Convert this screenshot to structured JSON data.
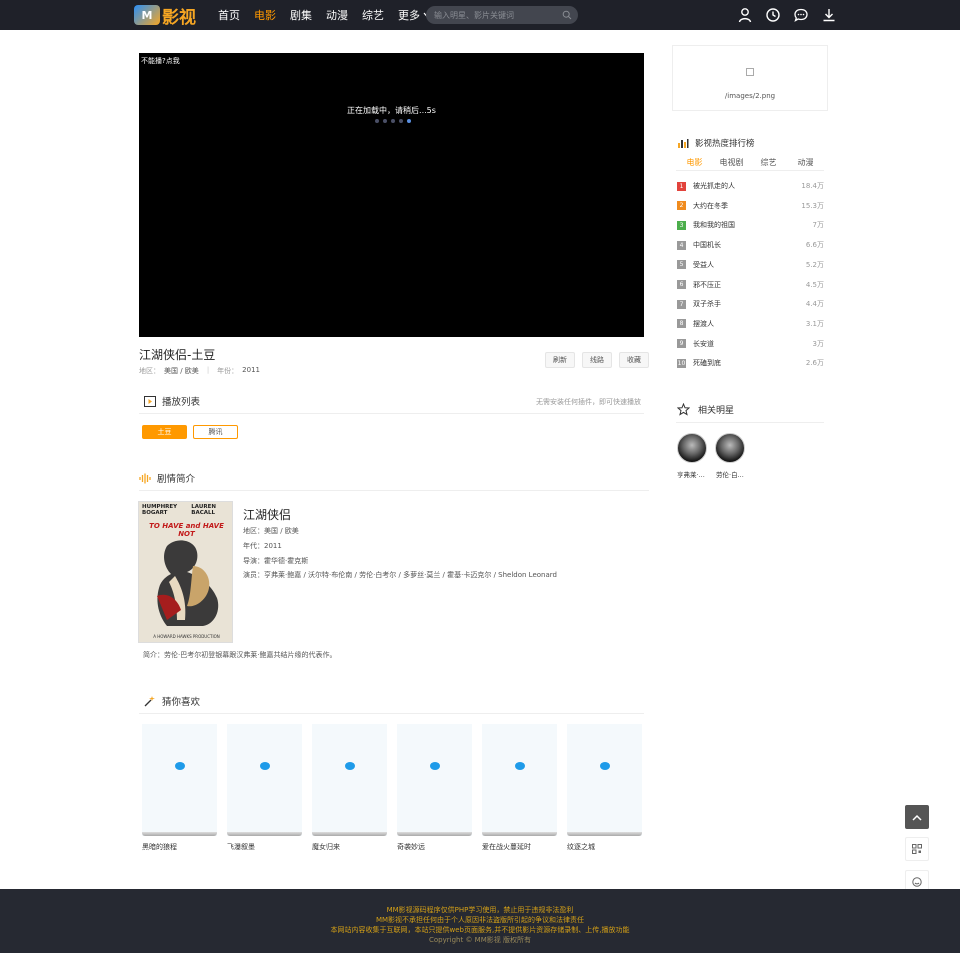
{
  "header": {
    "logo_mark": "M",
    "logo_text": "影视",
    "nav": [
      {
        "label": "首页",
        "active": false
      },
      {
        "label": "电影",
        "active": true
      },
      {
        "label": "剧集",
        "active": false
      },
      {
        "label": "动漫",
        "active": false
      },
      {
        "label": "综艺",
        "active": false
      }
    ],
    "more_label": "更多",
    "search_placeholder": "输入明星、影片关键词",
    "icons": [
      "user-icon",
      "history-icon",
      "message-icon",
      "download-icon"
    ]
  },
  "player": {
    "error_text": "不能播?点我",
    "loading_text": "正在加载中，请稍后...5s"
  },
  "video": {
    "title": "江湖侠侣-土豆",
    "region_label": "地区：",
    "region": "美国 / 欧美",
    "year_label": "年份：",
    "year": "2011",
    "actions": [
      "刷新",
      "线路",
      "收藏"
    ]
  },
  "playlist": {
    "heading": "播放列表",
    "note": "无需安装任何插件，即可快速播放",
    "sources": [
      "土豆",
      "腾讯"
    ]
  },
  "synopsis": {
    "heading": "剧情简介",
    "poster": {
      "actor_left": "HUMPHREY BOGART",
      "actor_right": "LAUREN BACALL",
      "title": "TO HAVE and HAVE NOT",
      "credit": "A HOWARD HAWKS PRODUCTION"
    },
    "title": "江湖侠侣",
    "rows": [
      "地区：美国 / 欧美",
      "年代：2011",
      "导演：霍华德·霍克斯",
      "演员：亨弗莱·鲍嘉 / 沃尔特·布伦南 / 劳伦·白考尔 / 多萝丝·莫兰 / 霍基·卡迈克尔 / Sheldon Leonard"
    ],
    "description": "简介：劳伦·巴考尔初登银幕跟汉弗莱·鲍嘉共结片缘的代表作。"
  },
  "recommend": {
    "heading": "猜你喜欢",
    "items": [
      "黑暗的狼程",
      "飞瀑叙墨",
      "魔女归来",
      "奇袭妙远",
      "爱在战火蔓延时",
      "纹逐之城"
    ]
  },
  "sidebar": {
    "ad_text": "/images/2.png",
    "rank": {
      "heading": "影视热度排行榜",
      "tabs": [
        "电影",
        "电视剧",
        "综艺",
        "动漫"
      ],
      "items": [
        {
          "no": "1",
          "name": "被光抓走的人",
          "count": "18.4万",
          "color": "#e2433c"
        },
        {
          "no": "2",
          "name": "大约在冬季",
          "count": "15.3万",
          "color": "#f08b1e"
        },
        {
          "no": "3",
          "name": "我和我的祖国",
          "count": "7万",
          "color": "#4cae4c"
        },
        {
          "no": "4",
          "name": "中国机长",
          "count": "6.6万",
          "color": "#999999"
        },
        {
          "no": "5",
          "name": "受益人",
          "count": "5.2万",
          "color": "#999999"
        },
        {
          "no": "6",
          "name": "邪不压正",
          "count": "4.5万",
          "color": "#999999"
        },
        {
          "no": "7",
          "name": "双子杀手",
          "count": "4.4万",
          "color": "#999999"
        },
        {
          "no": "8",
          "name": "摆渡人",
          "count": "3.1万",
          "color": "#999999"
        },
        {
          "no": "9",
          "name": "长安道",
          "count": "3万",
          "color": "#999999"
        },
        {
          "no": "10",
          "name": "死磕到底",
          "count": "2.6万",
          "color": "#999999"
        }
      ]
    },
    "stars": {
      "heading": "相关明星",
      "items": [
        "亨弗莱·...",
        "劳伦·白..."
      ]
    }
  },
  "footer": {
    "lines": [
      "MM影视源码程序仅供PHP学习使用，禁止用于违规非法盈利",
      "MM影视不承担任何由于个人原因非法盗版所引起的争议和法律责任",
      "本网站内容收集于互联网，本站只提供web页面服务,并不提供影片资源存储录制、上传,播放功能",
      "Copyright ©  MM影视 版权所有"
    ]
  },
  "colors": {
    "accent": "#ff9900",
    "header_bg": "#1f2129",
    "footer_bg": "#262932",
    "footer_text": "#d4a017"
  }
}
